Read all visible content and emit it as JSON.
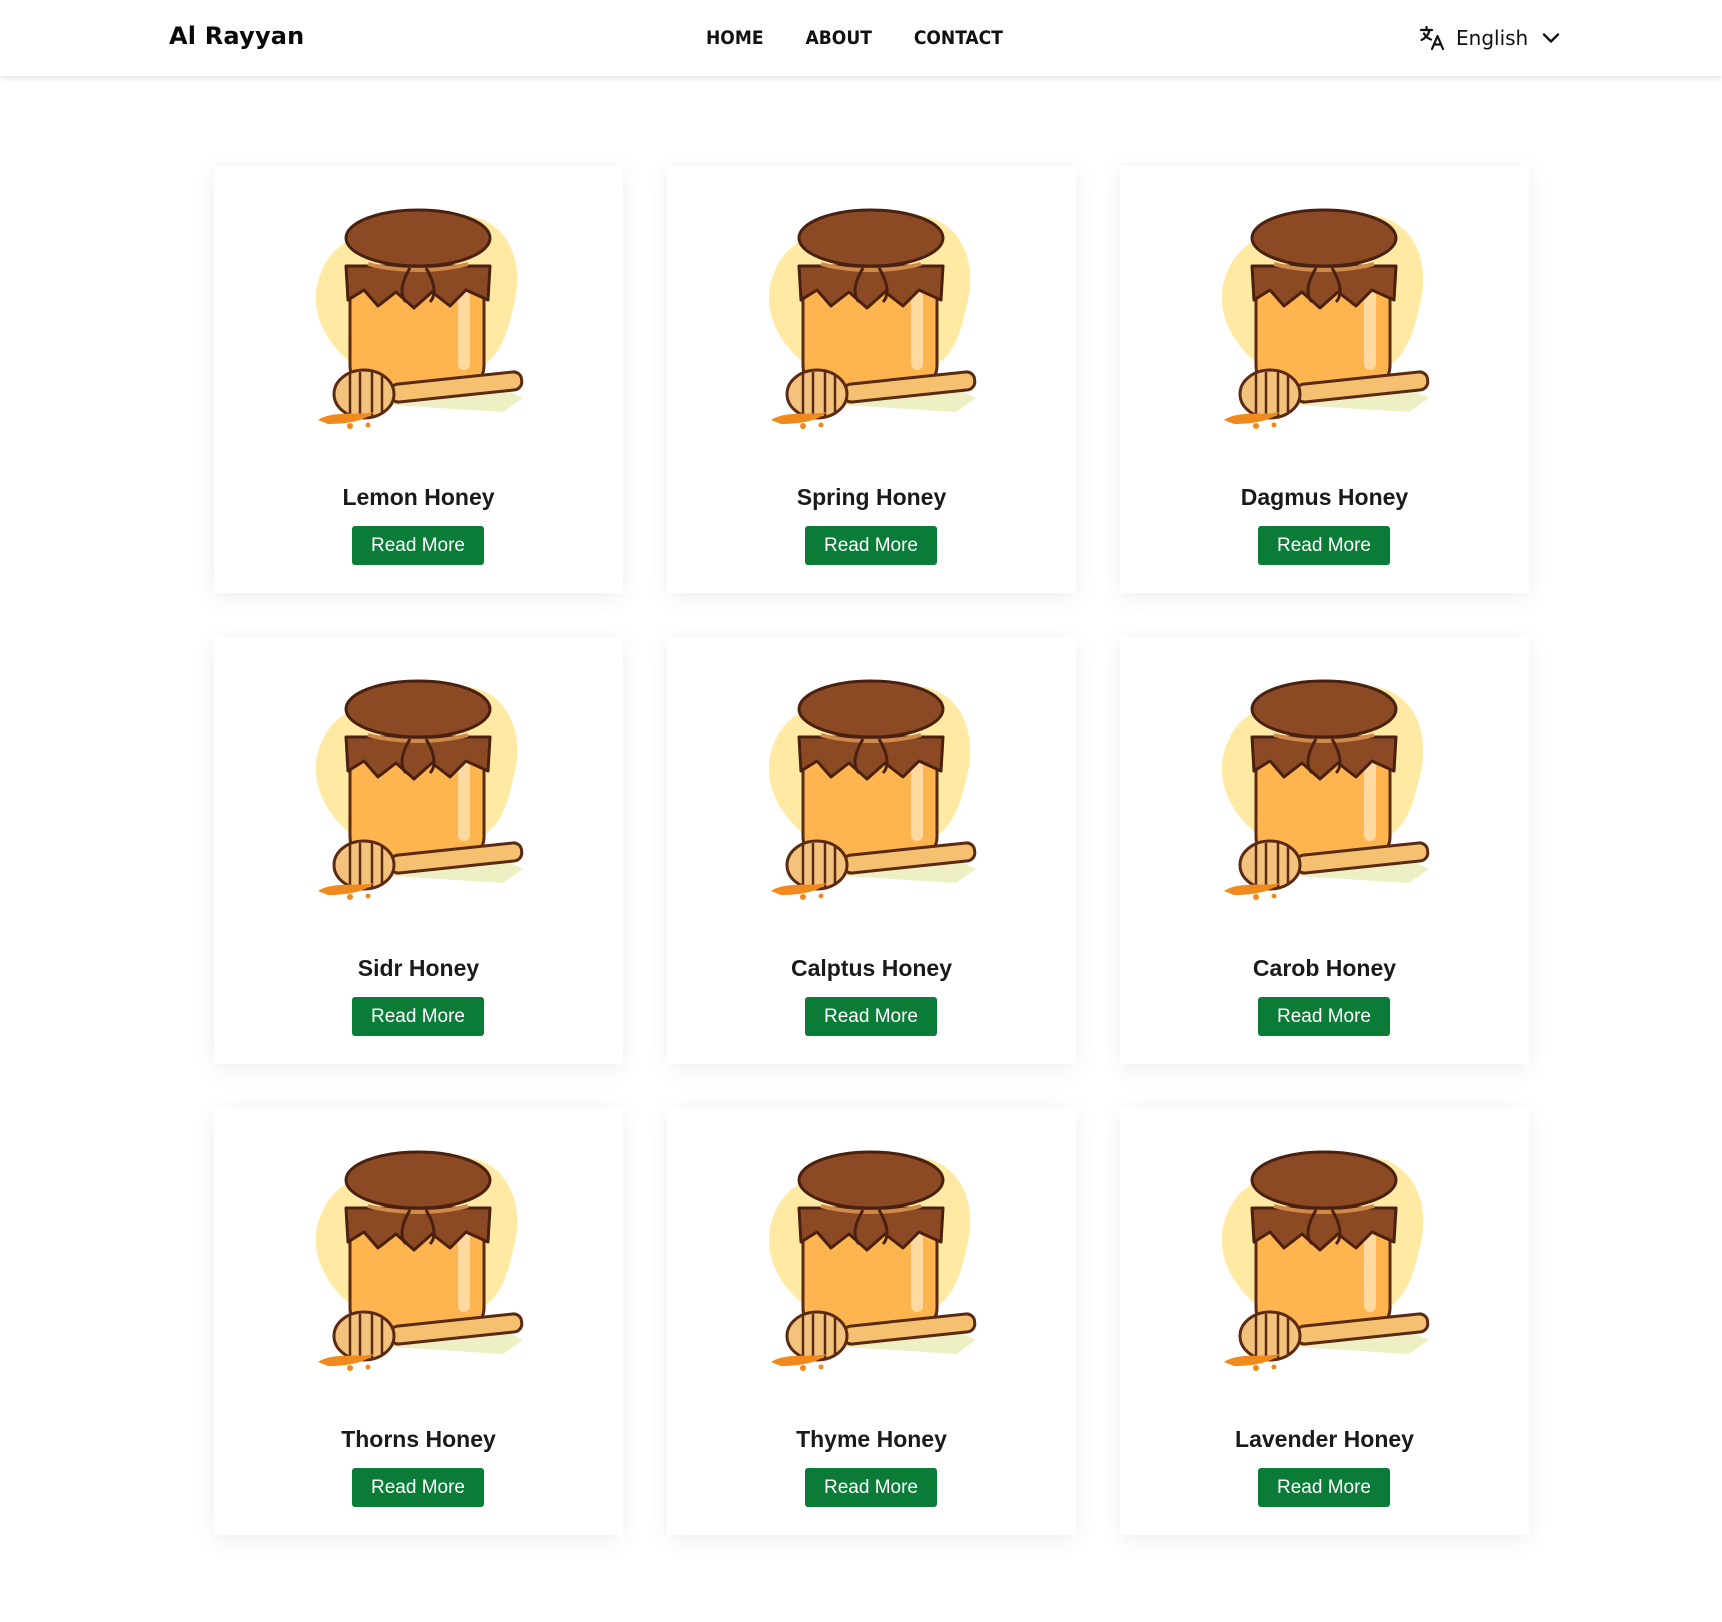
{
  "header": {
    "brand": "Al Rayyan",
    "nav": [
      "HOME",
      "ABOUT",
      "CONTACT"
    ],
    "language": {
      "label": "English",
      "icon": "translate-icon",
      "chevron": "chevron-down-icon"
    }
  },
  "colors": {
    "button": "#0a7c37",
    "jar_honey": "#ffb54f",
    "jar_cloth": "#8b4a23",
    "jar_glow": "#ffeaa6"
  },
  "products": [
    {
      "name": "Lemon Honey",
      "button": "Read More"
    },
    {
      "name": "Spring Honey",
      "button": "Read More"
    },
    {
      "name": "Dagmus Honey",
      "button": "Read More"
    },
    {
      "name": "Sidr Honey",
      "button": "Read More"
    },
    {
      "name": "Calptus Honey",
      "button": "Read More"
    },
    {
      "name": "Carob Honey",
      "button": "Read More"
    },
    {
      "name": "Thorns Honey",
      "button": "Read More"
    },
    {
      "name": "Thyme Honey",
      "button": "Read More"
    },
    {
      "name": "Lavender Honey",
      "button": "Read More"
    }
  ]
}
